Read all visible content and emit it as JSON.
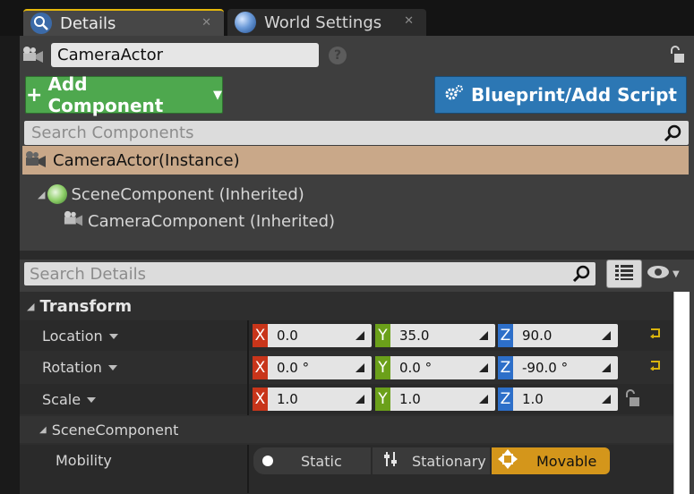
{
  "tabs": [
    {
      "label": "Details",
      "icon": "details-magnifier-icon",
      "active": true
    },
    {
      "label": "World Settings",
      "icon": "globe-icon",
      "active": false
    }
  ],
  "actor": {
    "name": "CameraActor",
    "help_icon": "question-icon",
    "lock_icon": "lock-icon"
  },
  "toolbar": {
    "add_component_label": "Add Component",
    "blueprint_label": "Blueprint/Add Script"
  },
  "components": {
    "search_placeholder": "Search Components",
    "instance_label": "CameraActor(Instance)",
    "tree": [
      {
        "label": "SceneComponent (Inherited)",
        "icon": "scene-component-icon"
      },
      {
        "label": "CameraComponent (Inherited)",
        "icon": "camera-component-icon"
      }
    ]
  },
  "details": {
    "search_placeholder": "Search Details"
  },
  "transform": {
    "header": "Transform",
    "rows": [
      {
        "label": "Location",
        "x": "0.0",
        "y": "35.0",
        "z": "90.0"
      },
      {
        "label": "Rotation",
        "x": "0.0 °",
        "y": "0.0 °",
        "z": "-90.0 °"
      },
      {
        "label": "Scale",
        "x": "1.0",
        "y": "1.0",
        "z": "1.0"
      }
    ],
    "axis_labels": {
      "x": "X",
      "y": "Y",
      "z": "Z"
    },
    "axis_colors": {
      "x": "#c8351a",
      "y": "#6ba01a",
      "z": "#2d6fc9"
    }
  },
  "scene_component": {
    "header": "SceneComponent",
    "mobility_label": "Mobility",
    "options": [
      "Static",
      "Stationary",
      "Movable"
    ],
    "selected": "Movable",
    "selected_color": "#d4961b"
  },
  "colors": {
    "add_button": "#4ea84e",
    "blueprint_button": "#2c77b4",
    "instance_row": "#c9a889",
    "active_tab_accent": "#e5b80b"
  }
}
